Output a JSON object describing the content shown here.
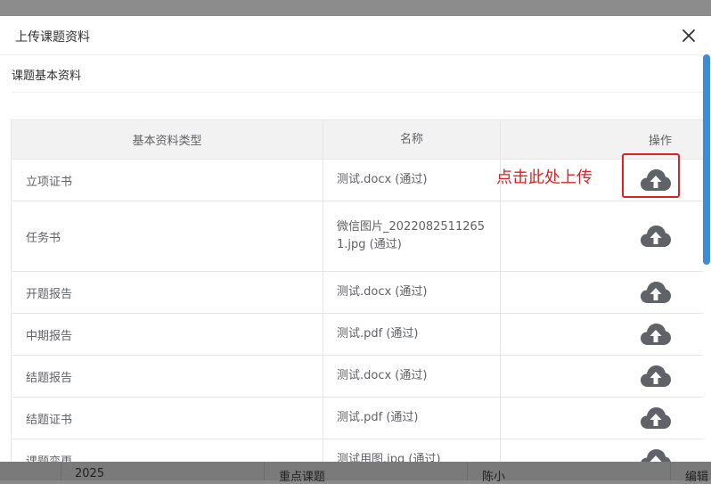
{
  "modal": {
    "title": "上传课题资料",
    "section_title": "课题基本资料"
  },
  "table": {
    "headers": [
      "基本资料类型",
      "名称",
      "操作"
    ],
    "rows": [
      {
        "type": "立项证书",
        "name": "测试.docx (通过)"
      },
      {
        "type": "任务书",
        "name": "微信图片_20220825112651.jpg (通过)"
      },
      {
        "type": "开题报告",
        "name": "测试.docx (通过)"
      },
      {
        "type": "中期报告",
        "name": "测试.pdf (通过)"
      },
      {
        "type": "结题报告",
        "name": "测试.docx (通过)"
      },
      {
        "type": "结题证书",
        "name": "测试.pdf (通过)"
      },
      {
        "type": "课题变更",
        "name": "测试用图.jpg (通过)"
      }
    ],
    "upload_icon": "cloud-upload-icon"
  },
  "annotation": "点击此处上传",
  "background_row": {
    "year": "2025",
    "category": "重点课题",
    "person": "陈小",
    "action": "编辑"
  },
  "colors": {
    "annotation": "#e02020",
    "scrollbar": "#3c8dd9",
    "icon": "#5f6266"
  }
}
